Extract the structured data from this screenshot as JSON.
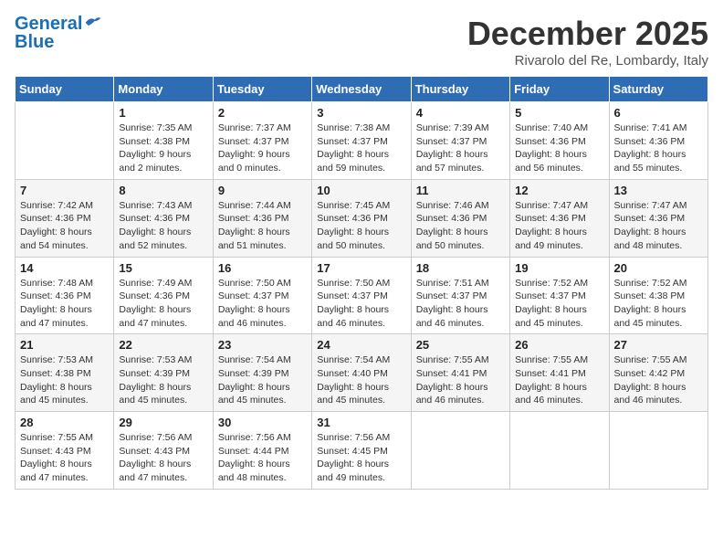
{
  "logo": {
    "general": "General",
    "blue": "Blue"
  },
  "header": {
    "month_year": "December 2025",
    "location": "Rivarolo del Re, Lombardy, Italy"
  },
  "weekdays": [
    "Sunday",
    "Monday",
    "Tuesday",
    "Wednesday",
    "Thursday",
    "Friday",
    "Saturday"
  ],
  "weeks": [
    [
      {
        "day": "",
        "info": ""
      },
      {
        "day": "1",
        "info": "Sunrise: 7:35 AM\nSunset: 4:38 PM\nDaylight: 9 hours\nand 2 minutes."
      },
      {
        "day": "2",
        "info": "Sunrise: 7:37 AM\nSunset: 4:37 PM\nDaylight: 9 hours\nand 0 minutes."
      },
      {
        "day": "3",
        "info": "Sunrise: 7:38 AM\nSunset: 4:37 PM\nDaylight: 8 hours\nand 59 minutes."
      },
      {
        "day": "4",
        "info": "Sunrise: 7:39 AM\nSunset: 4:37 PM\nDaylight: 8 hours\nand 57 minutes."
      },
      {
        "day": "5",
        "info": "Sunrise: 7:40 AM\nSunset: 4:36 PM\nDaylight: 8 hours\nand 56 minutes."
      },
      {
        "day": "6",
        "info": "Sunrise: 7:41 AM\nSunset: 4:36 PM\nDaylight: 8 hours\nand 55 minutes."
      }
    ],
    [
      {
        "day": "7",
        "info": "Sunrise: 7:42 AM\nSunset: 4:36 PM\nDaylight: 8 hours\nand 54 minutes."
      },
      {
        "day": "8",
        "info": "Sunrise: 7:43 AM\nSunset: 4:36 PM\nDaylight: 8 hours\nand 52 minutes."
      },
      {
        "day": "9",
        "info": "Sunrise: 7:44 AM\nSunset: 4:36 PM\nDaylight: 8 hours\nand 51 minutes."
      },
      {
        "day": "10",
        "info": "Sunrise: 7:45 AM\nSunset: 4:36 PM\nDaylight: 8 hours\nand 50 minutes."
      },
      {
        "day": "11",
        "info": "Sunrise: 7:46 AM\nSunset: 4:36 PM\nDaylight: 8 hours\nand 50 minutes."
      },
      {
        "day": "12",
        "info": "Sunrise: 7:47 AM\nSunset: 4:36 PM\nDaylight: 8 hours\nand 49 minutes."
      },
      {
        "day": "13",
        "info": "Sunrise: 7:47 AM\nSunset: 4:36 PM\nDaylight: 8 hours\nand 48 minutes."
      }
    ],
    [
      {
        "day": "14",
        "info": "Sunrise: 7:48 AM\nSunset: 4:36 PM\nDaylight: 8 hours\nand 47 minutes."
      },
      {
        "day": "15",
        "info": "Sunrise: 7:49 AM\nSunset: 4:36 PM\nDaylight: 8 hours\nand 47 minutes."
      },
      {
        "day": "16",
        "info": "Sunrise: 7:50 AM\nSunset: 4:37 PM\nDaylight: 8 hours\nand 46 minutes."
      },
      {
        "day": "17",
        "info": "Sunrise: 7:50 AM\nSunset: 4:37 PM\nDaylight: 8 hours\nand 46 minutes."
      },
      {
        "day": "18",
        "info": "Sunrise: 7:51 AM\nSunset: 4:37 PM\nDaylight: 8 hours\nand 46 minutes."
      },
      {
        "day": "19",
        "info": "Sunrise: 7:52 AM\nSunset: 4:37 PM\nDaylight: 8 hours\nand 45 minutes."
      },
      {
        "day": "20",
        "info": "Sunrise: 7:52 AM\nSunset: 4:38 PM\nDaylight: 8 hours\nand 45 minutes."
      }
    ],
    [
      {
        "day": "21",
        "info": "Sunrise: 7:53 AM\nSunset: 4:38 PM\nDaylight: 8 hours\nand 45 minutes."
      },
      {
        "day": "22",
        "info": "Sunrise: 7:53 AM\nSunset: 4:39 PM\nDaylight: 8 hours\nand 45 minutes."
      },
      {
        "day": "23",
        "info": "Sunrise: 7:54 AM\nSunset: 4:39 PM\nDaylight: 8 hours\nand 45 minutes."
      },
      {
        "day": "24",
        "info": "Sunrise: 7:54 AM\nSunset: 4:40 PM\nDaylight: 8 hours\nand 45 minutes."
      },
      {
        "day": "25",
        "info": "Sunrise: 7:55 AM\nSunset: 4:41 PM\nDaylight: 8 hours\nand 46 minutes."
      },
      {
        "day": "26",
        "info": "Sunrise: 7:55 AM\nSunset: 4:41 PM\nDaylight: 8 hours\nand 46 minutes."
      },
      {
        "day": "27",
        "info": "Sunrise: 7:55 AM\nSunset: 4:42 PM\nDaylight: 8 hours\nand 46 minutes."
      }
    ],
    [
      {
        "day": "28",
        "info": "Sunrise: 7:55 AM\nSunset: 4:43 PM\nDaylight: 8 hours\nand 47 minutes."
      },
      {
        "day": "29",
        "info": "Sunrise: 7:56 AM\nSunset: 4:43 PM\nDaylight: 8 hours\nand 47 minutes."
      },
      {
        "day": "30",
        "info": "Sunrise: 7:56 AM\nSunset: 4:44 PM\nDaylight: 8 hours\nand 48 minutes."
      },
      {
        "day": "31",
        "info": "Sunrise: 7:56 AM\nSunset: 4:45 PM\nDaylight: 8 hours\nand 49 minutes."
      },
      {
        "day": "",
        "info": ""
      },
      {
        "day": "",
        "info": ""
      },
      {
        "day": "",
        "info": ""
      }
    ]
  ]
}
